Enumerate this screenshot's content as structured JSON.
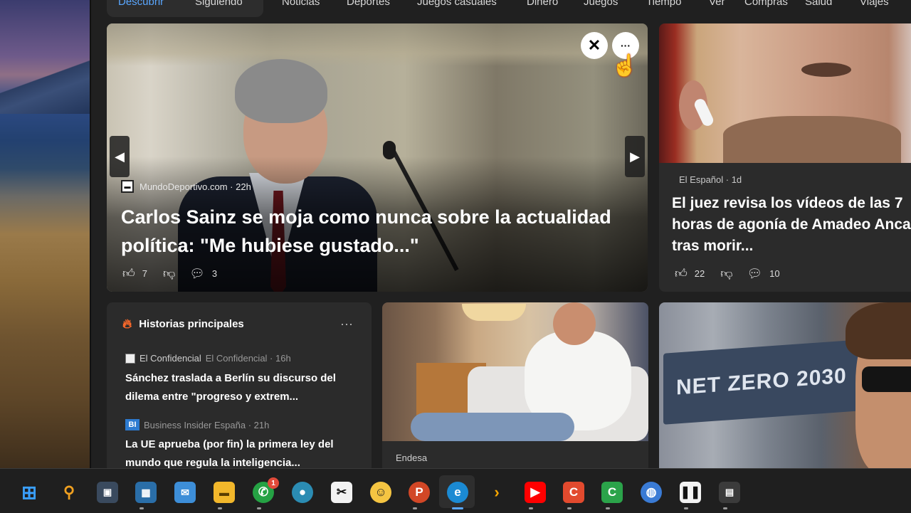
{
  "nav": {
    "tabs": [
      {
        "label": "Descubrir"
      },
      {
        "label": "Siguiendo"
      },
      {
        "label": "Noticias"
      },
      {
        "label": "Deportes"
      },
      {
        "label": "Juegos casuales"
      },
      {
        "label": "Dinero"
      },
      {
        "label": "Juegos"
      },
      {
        "label": "Tiempo"
      },
      {
        "label": "Ver"
      },
      {
        "label": "Compras"
      },
      {
        "label": "Salud"
      },
      {
        "label": "Viajes"
      }
    ]
  },
  "hero": {
    "source": "MundoDeportivo.com · 22h",
    "headline": "Carlos Sainz se moja como nunca sobre la actualidad política: \"Me hubiese gustado...\"",
    "likes": "7",
    "comments": "3",
    "close_symbol": "✕",
    "more_symbol": "···"
  },
  "right_card": {
    "source": "El Español · 1d",
    "headline": "El juez revisa los vídeos de las 7 horas de agonía de Amadeo Anca tras morir...",
    "likes": "22",
    "comments": "10"
  },
  "historias": {
    "title": "Historias principales",
    "items": [
      {
        "logo_alt": "El Confidencial",
        "source": "El Confidencial · 16h",
        "title": "Sánchez traslada a Berlín su discurso del dilema entre \"progreso y extrem..."
      },
      {
        "logo_text": "BI",
        "source": "Business Insider España · 21h",
        "title": "La UE aprueba (por fin) la primera ley del mundo que regula la inteligencia..."
      }
    ]
  },
  "endesa_card": {
    "label": "Endesa"
  },
  "f1_card": {
    "banner_text": "NET ZERO 2030"
  },
  "taskbar": {
    "whatsapp_badge": "1"
  }
}
